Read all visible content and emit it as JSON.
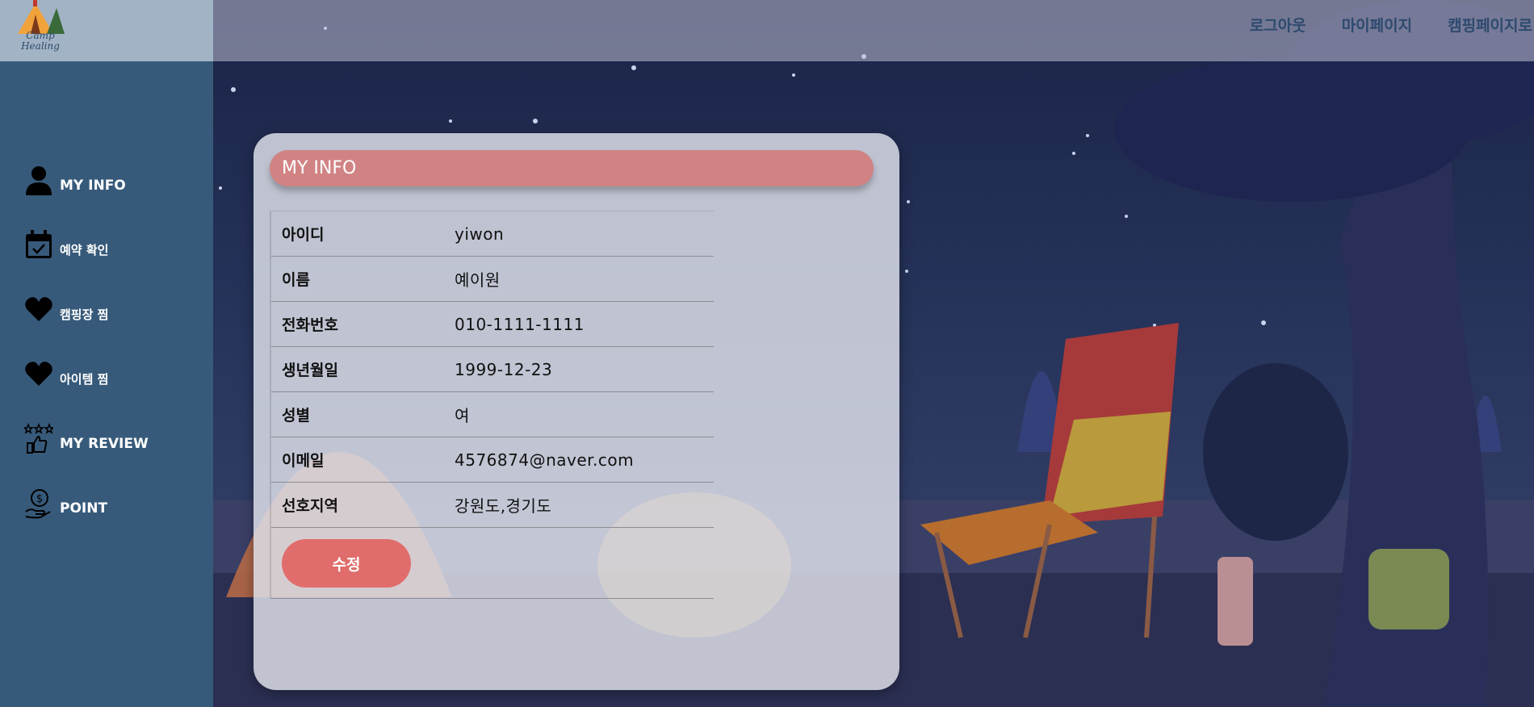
{
  "brand": {
    "logo_text_line1": "Camp",
    "logo_text_line2": "Healing"
  },
  "top_nav": {
    "logout": "로그아웃",
    "mypage": "마이페이지",
    "camping_page": "캠핑페이지로"
  },
  "sidebar": {
    "items": [
      {
        "label": "MY INFO",
        "icon": "person-icon"
      },
      {
        "label": "예약 확인",
        "icon": "calendar-check-icon"
      },
      {
        "label": "캠핑장 찜",
        "icon": "heart-icon"
      },
      {
        "label": "아이템 찜",
        "icon": "heart-icon"
      },
      {
        "label": "MY REVIEW",
        "icon": "stars-thumbs-up-icon"
      },
      {
        "label": "POINT",
        "icon": "hand-dollar-icon"
      }
    ]
  },
  "main": {
    "title": "MY INFO",
    "fields": [
      {
        "label": "아이디",
        "value": "yiwon"
      },
      {
        "label": "이름",
        "value": "예이원"
      },
      {
        "label": "전화번호",
        "value": "010-1111-1111"
      },
      {
        "label": "생년월일",
        "value": "1999-12-23"
      },
      {
        "label": "성별",
        "value": "여"
      },
      {
        "label": "이메일",
        "value": "4576874@naver.com"
      },
      {
        "label": "선호지역",
        "value": "강원도,경기도"
      }
    ],
    "edit_button": "수정"
  },
  "colors": {
    "sidebar": "#375a7a",
    "title_bar": "#d18384",
    "button": "#e06d6b",
    "nav_text": "#2d4a6e"
  }
}
